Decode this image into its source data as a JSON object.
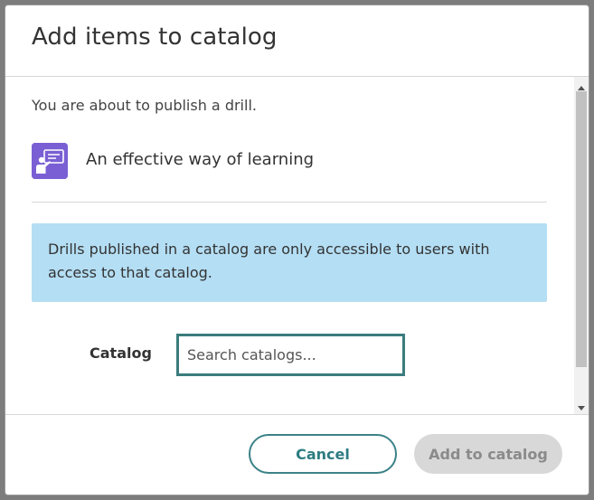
{
  "dialog": {
    "title": "Add items to catalog",
    "intro": "You are about to publish a drill.",
    "item": {
      "title": "An effective way of learning",
      "icon": "presentation-board-icon"
    },
    "info_message": "Drills published in a catalog are only accessible to users with access to that catalog.",
    "catalog": {
      "label": "Catalog",
      "placeholder": "Search catalogs...",
      "value": ""
    },
    "buttons": {
      "cancel": "Cancel",
      "add": "Add to catalog"
    }
  },
  "colors": {
    "accent": "#3b7c7d",
    "info_background": "#b4def4",
    "icon_background": "#7a5fd4",
    "disabled_button": "#d8d8d8"
  }
}
